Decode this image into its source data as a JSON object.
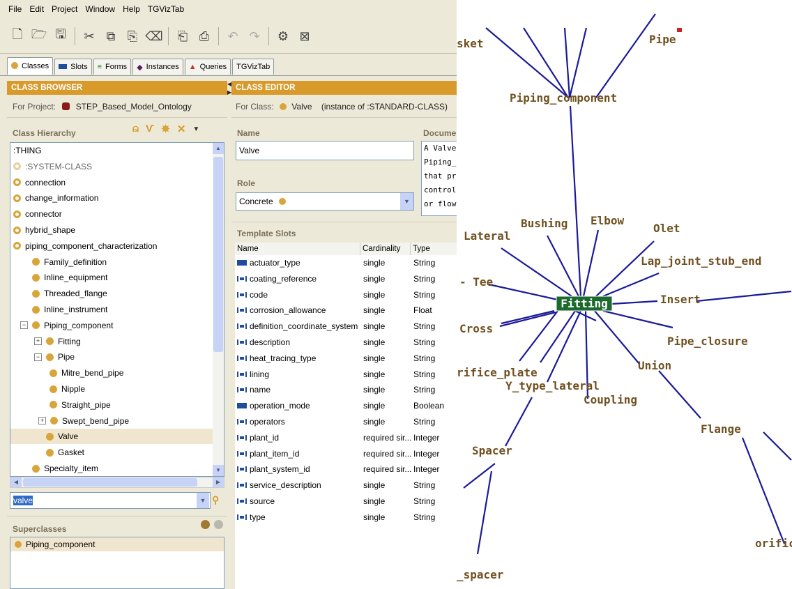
{
  "menu": [
    "File",
    "Edit",
    "Project",
    "Window",
    "Help",
    "TGVizTab"
  ],
  "toolbar_icons": [
    "new-file-icon",
    "open-folder-icon",
    "save-icon",
    "cut-icon",
    "copy-icon",
    "paste-icon",
    "clear-icon",
    "insert-icon",
    "export-icon",
    "undo-icon",
    "redo-icon",
    "config-icon",
    "close-project-icon"
  ],
  "tabs": [
    {
      "label": "Classes",
      "icon": "class-icon",
      "active": true
    },
    {
      "label": "Slots",
      "icon": "slot-icon"
    },
    {
      "label": "Forms",
      "icon": "form-icon"
    },
    {
      "label": "Instances",
      "icon": "instance-icon"
    },
    {
      "label": "Queries",
      "icon": "query-icon"
    },
    {
      "label": "TGVizTab",
      "icon": ""
    }
  ],
  "browser": {
    "header": "CLASS BROWSER",
    "project_label": "For Project:",
    "project_name": "STEP_Based_Model_Ontology",
    "hierarchy_label": "Class Hierarchy",
    "tree": [
      {
        "label": ":THING",
        "level": 0,
        "icon": "none"
      },
      {
        "label": ":SYSTEM-CLASS",
        "level": 0,
        "icon": "ringpale",
        "muted": true
      },
      {
        "label": "connection",
        "level": 0,
        "icon": "ring"
      },
      {
        "label": "change_information",
        "level": 0,
        "icon": "ring"
      },
      {
        "label": "connector",
        "level": 0,
        "icon": "ring"
      },
      {
        "label": "hybrid_shape",
        "level": 0,
        "icon": "ring"
      },
      {
        "label": "piping_component_characterization",
        "level": 0,
        "icon": "ring"
      },
      {
        "label": "Family_definition",
        "level": 1,
        "icon": "solid"
      },
      {
        "label": "Inline_equipment",
        "level": 1,
        "icon": "solid"
      },
      {
        "label": "Threaded_flange",
        "level": 1,
        "icon": "solid"
      },
      {
        "label": "Inline_instrument",
        "level": 1,
        "icon": "solid"
      },
      {
        "label": "Piping_component",
        "level": 1,
        "icon": "solid",
        "toggle": "−"
      },
      {
        "label": "Fitting",
        "level": 2,
        "icon": "solid",
        "toggle": "+"
      },
      {
        "label": "Pipe",
        "level": 2,
        "icon": "solid",
        "toggle": "−"
      },
      {
        "label": "Mitre_bend_pipe",
        "level": 3,
        "icon": "solid"
      },
      {
        "label": "Nipple",
        "level": 3,
        "icon": "solid"
      },
      {
        "label": "Straight_pipe",
        "level": 3,
        "icon": "solid"
      },
      {
        "label": "Swept_bend_pipe",
        "level": 3,
        "icon": "solid",
        "toggle": "+"
      },
      {
        "label": "Valve",
        "level": 2,
        "icon": "solid",
        "selected": true
      },
      {
        "label": "Gasket",
        "level": 2,
        "icon": "solid"
      },
      {
        "label": "Specialty_item",
        "level": 1,
        "icon": "solid"
      }
    ],
    "search_value": "valve",
    "superclasses_label": "Superclasses",
    "superclasses": [
      "Piping_component"
    ]
  },
  "editor": {
    "header": "CLASS EDITOR",
    "for_class_label": "For Class:",
    "class_name": "Valve",
    "instance_of": "(instance of :STANDARD-CLASS)",
    "name_label": "Name",
    "name_value": "Valve",
    "doc_label": "Docume",
    "doc_lines": [
      "A Valve",
      "Piping_",
      "that pr",
      "control",
      "or flow"
    ],
    "role_label": "Role",
    "role_value": "Concrete",
    "template_slots_label": "Template Slots",
    "columns": [
      "Name",
      "Cardinality",
      "Type"
    ],
    "slots": [
      {
        "name": "actuator_type",
        "cardinality": "single",
        "type": "String",
        "icon": "solid"
      },
      {
        "name": "coating_reference",
        "cardinality": "single",
        "type": "String",
        "icon": "bracket"
      },
      {
        "name": "code",
        "cardinality": "single",
        "type": "String",
        "icon": "bracket"
      },
      {
        "name": "corrosion_allowance",
        "cardinality": "single",
        "type": "Float",
        "icon": "bracket"
      },
      {
        "name": "definition_coordinate_system",
        "cardinality": "single",
        "type": "String",
        "icon": "bracket"
      },
      {
        "name": "description",
        "cardinality": "single",
        "type": "String",
        "icon": "bracket"
      },
      {
        "name": "heat_tracing_type",
        "cardinality": "single",
        "type": "String",
        "icon": "bracket"
      },
      {
        "name": "lining",
        "cardinality": "single",
        "type": "String",
        "icon": "bracket"
      },
      {
        "name": "name",
        "cardinality": "single",
        "type": "String",
        "icon": "bracket"
      },
      {
        "name": "operation_mode",
        "cardinality": "single",
        "type": "Boolean",
        "icon": "solid"
      },
      {
        "name": "operators",
        "cardinality": "single",
        "type": "String",
        "icon": "bracket"
      },
      {
        "name": "plant_id",
        "cardinality": "required sir...",
        "type": "Integer",
        "icon": "bracket"
      },
      {
        "name": "plant_item_id",
        "cardinality": "required sir...",
        "type": "Integer",
        "icon": "bracket"
      },
      {
        "name": "plant_system_id",
        "cardinality": "required sir...",
        "type": "Integer",
        "icon": "bracket"
      },
      {
        "name": "service_description",
        "cardinality": "single",
        "type": "String",
        "icon": "bracket"
      },
      {
        "name": "source",
        "cardinality": "single",
        "type": "String",
        "icon": "bracket"
      },
      {
        "name": "type",
        "cardinality": "single",
        "type": "String",
        "icon": "bracket"
      }
    ]
  },
  "graph": {
    "center": "Fitting",
    "nodes": [
      "sket",
      "Pipe",
      "Piping_component",
      "Bushing",
      "Elbow",
      "Olet",
      "Lateral",
      "Lap_joint_stub_end",
      "Tee",
      "Insert",
      "Cross",
      "Pipe_closure",
      "rifice_plate",
      "Union",
      "Y_type_lateral",
      "Coupling",
      "Flange",
      "Spacer",
      "orific",
      "_spacer"
    ],
    "colors": {
      "edge": "#1a1a99",
      "label": "#705020",
      "center_bg": "#1c6b2e",
      "center_text": "#ffffff"
    }
  }
}
